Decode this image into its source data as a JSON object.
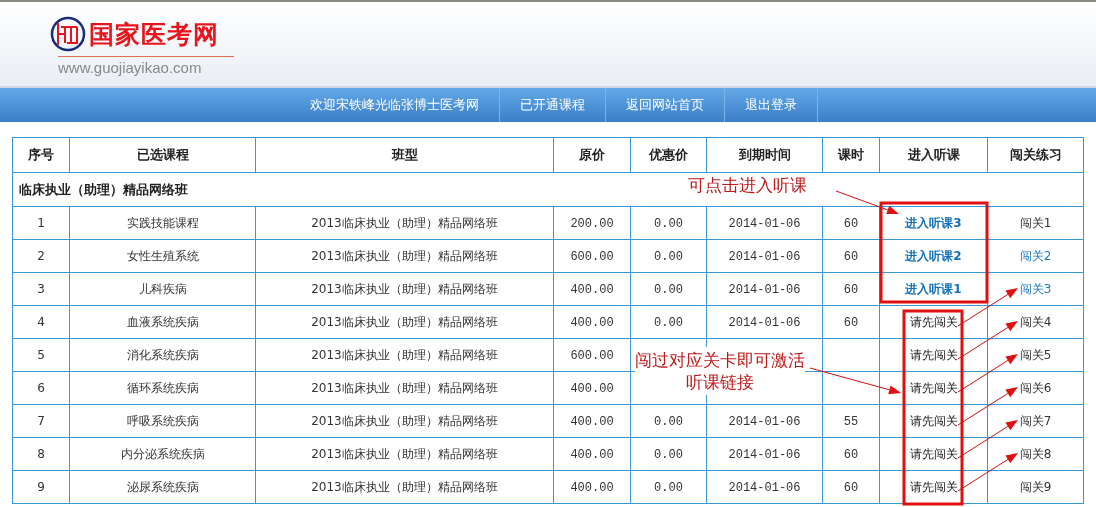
{
  "header": {
    "logo_text": "国家医考网",
    "logo_url": "www.guojiayikao.com"
  },
  "nav": [
    {
      "label": "欢迎宋铁峰光临张博士医考网"
    },
    {
      "label": "已开通课程"
    },
    {
      "label": "返回网站首页"
    },
    {
      "label": "退出登录"
    }
  ],
  "table": {
    "columns": [
      "序号",
      "已选课程",
      "班型",
      "原价",
      "优惠价",
      "到期时间",
      "课时",
      "进入听课",
      "闯关练习"
    ],
    "group": "临床执业（助理）精品网络班",
    "rows": [
      {
        "no": "1",
        "course": "实践技能课程",
        "class": "2013临床执业（助理）精品网络班",
        "price": "200.00",
        "discount": "0.00",
        "expires": "2014-01-06",
        "hours": "60",
        "lecture": {
          "kind": "link",
          "text": "进入听课3"
        },
        "practice": {
          "text": "闯关1",
          "linked": false
        }
      },
      {
        "no": "2",
        "course": "女性生殖系统",
        "class": "2013临床执业（助理）精品网络班",
        "price": "600.00",
        "discount": "0.00",
        "expires": "2014-01-06",
        "hours": "60",
        "lecture": {
          "kind": "link",
          "text": "进入听课2"
        },
        "practice": {
          "text": "闯关2",
          "linked": true
        }
      },
      {
        "no": "3",
        "course": "儿科疾病",
        "class": "2013临床执业（助理）精品网络班",
        "price": "400.00",
        "discount": "0.00",
        "expires": "2014-01-06",
        "hours": "60",
        "lecture": {
          "kind": "link",
          "text": "进入听课1"
        },
        "practice": {
          "text": "闯关3",
          "linked": true
        }
      },
      {
        "no": "4",
        "course": "血液系统疾病",
        "class": "2013临床执业（助理）精品网络班",
        "price": "400.00",
        "discount": "0.00",
        "expires": "2014-01-06",
        "hours": "60",
        "lecture": {
          "kind": "locked",
          "text": "请先闯关"
        },
        "practice": {
          "text": "闯关4",
          "linked": false
        }
      },
      {
        "no": "5",
        "course": "消化系统疾病",
        "class": "2013临床执业（助理）精品网络班",
        "price": "600.00",
        "lecture": {
          "kind": "locked",
          "text": "请先闯关"
        },
        "practice": {
          "text": "闯关5",
          "linked": false
        }
      },
      {
        "no": "6",
        "course": "循环系统疾病",
        "class": "2013临床执业（助理）精品网络班",
        "price": "400.00",
        "lecture": {
          "kind": "locked",
          "text": "请先闯关"
        },
        "practice": {
          "text": "闯关6",
          "linked": false
        }
      },
      {
        "no": "7",
        "course": "呼吸系统疾病",
        "class": "2013临床执业（助理）精品网络班",
        "price": "400.00",
        "discount": "0.00",
        "expires": "2014-01-06",
        "hours": "55",
        "lecture": {
          "kind": "locked",
          "text": "请先闯关"
        },
        "practice": {
          "text": "闯关7",
          "linked": false
        }
      },
      {
        "no": "8",
        "course": "内分泌系统疾病",
        "class": "2013临床执业（助理）精品网络班",
        "price": "400.00",
        "discount": "0.00",
        "expires": "2014-01-06",
        "hours": "60",
        "lecture": {
          "kind": "locked",
          "text": "请先闯关"
        },
        "practice": {
          "text": "闯关8",
          "linked": false
        }
      },
      {
        "no": "9",
        "course": "泌尿系统疾病",
        "class": "2013临床执业（助理）精品网络班",
        "price": "400.00",
        "discount": "0.00",
        "expires": "2014-01-06",
        "hours": "60",
        "lecture": {
          "kind": "locked",
          "text": "请先闯关"
        },
        "practice": {
          "text": "闯关9",
          "linked": false
        }
      }
    ]
  },
  "annotations": [
    {
      "text": "可点击进入听课"
    },
    {
      "text": "闯过对应关卡即可激活听课链接"
    }
  ]
}
